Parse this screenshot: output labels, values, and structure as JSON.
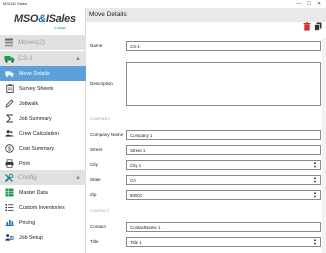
{
  "window": {
    "title": "MSO&I Sales",
    "minimize": "—",
    "maximize": "☐",
    "close": "✕"
  },
  "logo": {
    "brand_a": "MSO",
    "brand_amp": "&",
    "brand_b": "ISales",
    "sub_by": "by",
    "sub_name": "Dimis"
  },
  "sidebar": {
    "moves_header": {
      "label": "Moves(2)"
    },
    "move_header": {
      "label": "CS-1"
    },
    "config_header": {
      "label": "Config"
    },
    "move_items": [
      {
        "label": "Move Details",
        "icon": "truck-icon",
        "active": true
      },
      {
        "label": "Survey Sheets",
        "icon": "clipboard-icon"
      },
      {
        "label": "Jobwalk",
        "icon": "edit-icon"
      },
      {
        "label": "Job Summary",
        "icon": "sigma-icon"
      },
      {
        "label": "Crew Calculation",
        "icon": "people-icon"
      },
      {
        "label": "Cost Summary",
        "icon": "dollar-icon"
      },
      {
        "label": "Print",
        "icon": "printer-icon"
      }
    ],
    "config_items": [
      {
        "label": "Master Data",
        "icon": "grid-icon"
      },
      {
        "label": "Custom Inventories",
        "icon": "list-icon"
      },
      {
        "label": "Pricing",
        "icon": "pricing-icon"
      },
      {
        "label": "Job Setup",
        "icon": "setup-icon"
      }
    ]
  },
  "main": {
    "title": "Move Details",
    "fields": {
      "name": {
        "label": "Name",
        "value": "CS-1"
      },
      "description": {
        "label": "Description",
        "value": ""
      },
      "company_section": "COMPANY",
      "company_name": {
        "label": "Company Name",
        "value": "Company 1"
      },
      "street": {
        "label": "Street",
        "value": "Street 1"
      },
      "city": {
        "label": "City",
        "value": "City 1"
      },
      "state": {
        "label": "State",
        "value": "CA"
      },
      "zip": {
        "label": "Zip",
        "value": "90001"
      },
      "contact_section": "CONTACT",
      "contact": {
        "label": "Contact",
        "value": "ContactName 1"
      },
      "title": {
        "label": "Title",
        "value": "Title 1"
      }
    }
  },
  "colors": {
    "active": "#5ba0d9",
    "delete": "#d9302c",
    "section_bg": "#e1e1e1"
  }
}
